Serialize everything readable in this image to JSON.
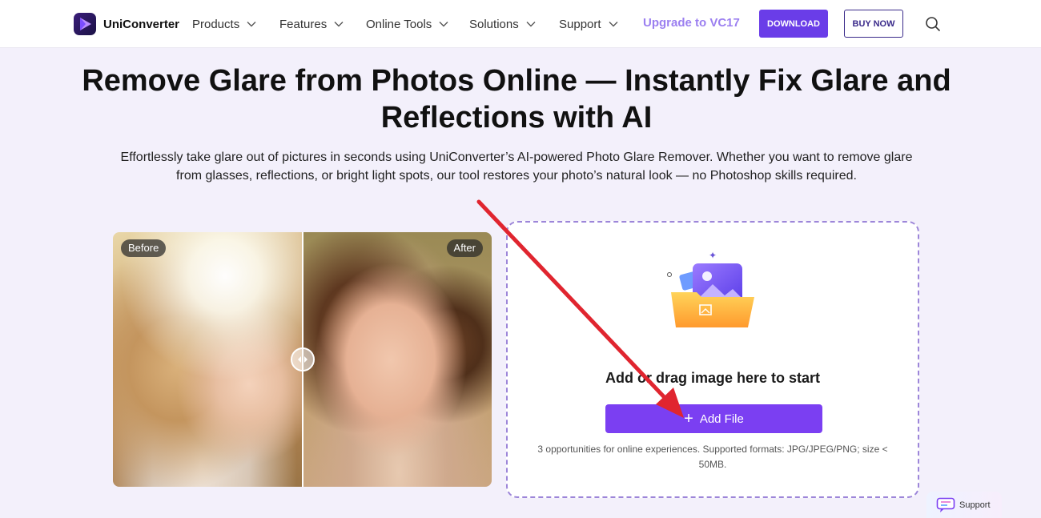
{
  "nav": {
    "brand": "UniConverter",
    "items": [
      {
        "label": "Products"
      },
      {
        "label": "Features"
      },
      {
        "label": "Online Tools"
      },
      {
        "label": "Solutions"
      },
      {
        "label": "Support"
      }
    ],
    "upgrade_label": "Upgrade to VC17",
    "download_label": "DOWNLOAD",
    "buy_label": "BUY NOW",
    "search_icon": "search-icon"
  },
  "hero": {
    "title_line1": "Remove Glare from Photos Online — Instantly Fix Glare and",
    "title_line2": "Reflections with AI",
    "subtitle_line1": "Effortlessly take glare out of pictures in seconds using UniConverter’s AI-powered Photo Glare Remover. Whether you want to remove glare",
    "subtitle_line2": "from glasses, reflections, or bright light spots, our tool restores your photo’s natural look — no Photoshop skills required."
  },
  "compare": {
    "before_label": "Before",
    "after_label": "After"
  },
  "upload": {
    "prompt": "Add or drag image here to start",
    "button_label": "Add File",
    "note_line1": "3 opportunities for online experiences. Supported formats: JPG/JPEG/PNG; size <",
    "note_line2": "50MB."
  },
  "support": {
    "label": "Support"
  },
  "colors": {
    "accent": "#7b3ff2",
    "download_bg": "#6a3de8",
    "upgrade_text": "#9b7ff0",
    "annotation_arrow": "#e0252f"
  }
}
